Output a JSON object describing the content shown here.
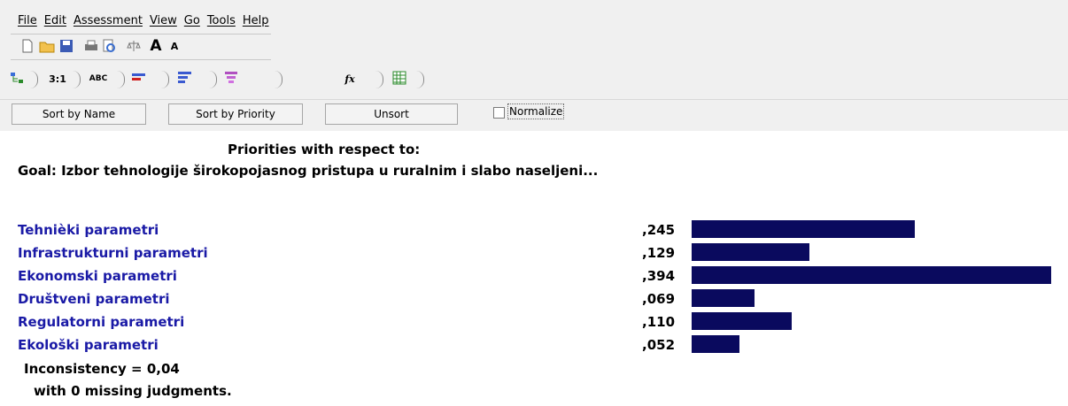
{
  "menu": [
    "File",
    "Edit",
    "Assessment",
    "View",
    "Go",
    "Tools",
    "Help"
  ],
  "toolbar_icons": [
    "new-file-icon",
    "open-folder-icon",
    "save-icon",
    "print-icon",
    "print-preview-icon",
    "scale-icon",
    "font-larger-icon",
    "font-smaller-icon"
  ],
  "tabs": [
    {
      "icon": "tree-icon",
      "label": ""
    },
    {
      "icon": "",
      "label": "3:1"
    },
    {
      "icon": "",
      "label": "ABC"
    },
    {
      "icon": "bars-red-icon",
      "label": ""
    },
    {
      "icon": "bars-blue-icon",
      "label": ""
    },
    {
      "icon": "hierarchy-icon",
      "label": ""
    },
    {
      "icon": "formula-icon",
      "label": "fx"
    },
    {
      "icon": "grid-icon",
      "label": ""
    }
  ],
  "sort": {
    "by_name": "Sort by Name",
    "by_priority": "Sort by Priority",
    "unsort": "Unsort",
    "normalize": "Normalize"
  },
  "heading": "Priorities with respect to:",
  "goal": "Goal: Izbor tehnologije širokopojasnog pristupa u ruralnim i slabo naseljeni...",
  "items": [
    {
      "name": "Tehnièki parametri",
      "value": ",245",
      "priority": 0.245
    },
    {
      "name": "Infrastrukturni parametri",
      "value": ",129",
      "priority": 0.129
    },
    {
      "name": "Ekonomski parametri",
      "value": ",394",
      "priority": 0.394
    },
    {
      "name": "Društveni parametri",
      "value": ",069",
      "priority": 0.069
    },
    {
      "name": "Regulatorni parametri",
      "value": ",110",
      "priority": 0.11
    },
    {
      "name": "Ekološki parametri",
      "value": ",052",
      "priority": 0.052
    }
  ],
  "inconsistency": "Inconsistency = 0,04",
  "missing": "with 0  missing judgments.",
  "colors": {
    "bar": "#0a0a5e",
    "item_text": "#1a1aa6"
  }
}
